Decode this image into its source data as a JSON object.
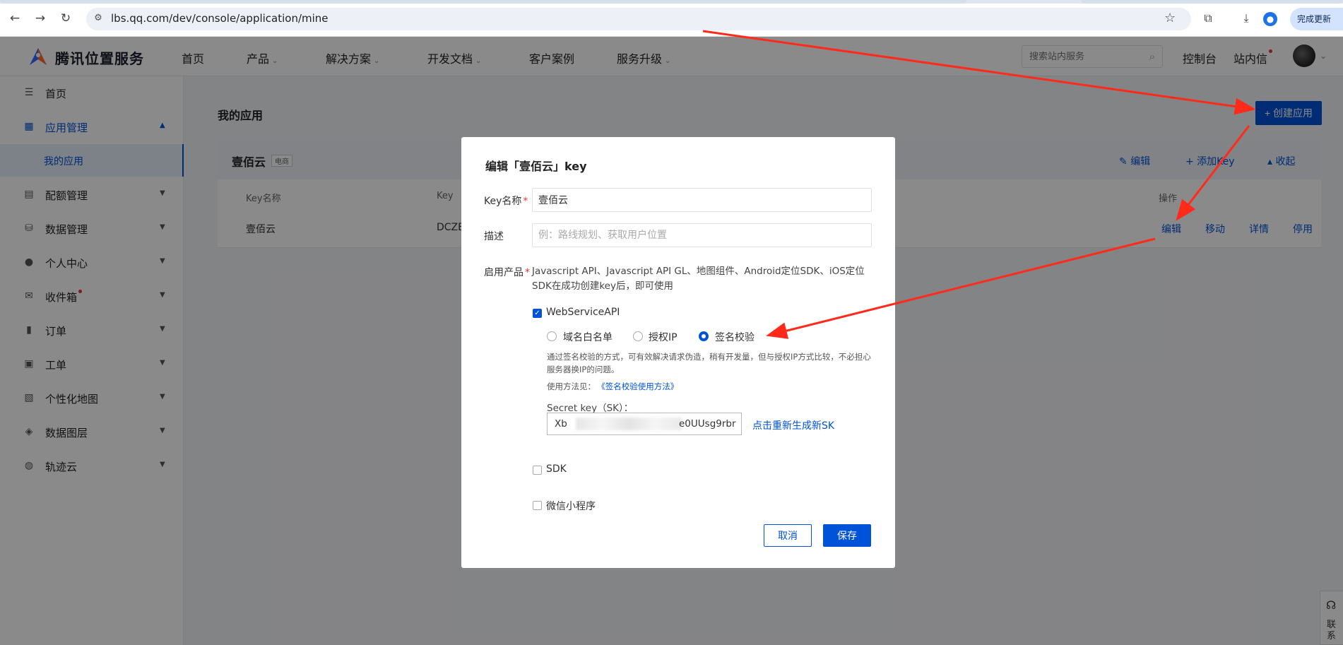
{
  "browser": {
    "url": "lbs.qq.com/dev/console/application/mine",
    "update_button": "完成更新"
  },
  "header": {
    "logo_text": "腾讯位置服务",
    "nav": [
      "首页",
      "产品",
      "解决方案",
      "开发文档",
      "客户案例",
      "服务升级"
    ],
    "search_placeholder": "搜索站内服务",
    "console_link": "控制台",
    "inbox_link": "站内信"
  },
  "sidebar": {
    "items": [
      {
        "label": "首页",
        "icon": "list-icon"
      },
      {
        "label": "应用管理",
        "icon": "grid-icon"
      },
      {
        "label": "我的应用"
      },
      {
        "label": "配额管理",
        "icon": "chart-icon"
      },
      {
        "label": "数据管理",
        "icon": "database-icon"
      },
      {
        "label": "个人中心",
        "icon": "user-icon"
      },
      {
        "label": "收件箱",
        "icon": "mail-icon"
      },
      {
        "label": "订单",
        "icon": "clipboard-icon"
      },
      {
        "label": "工单",
        "icon": "ticket-icon"
      },
      {
        "label": "个性化地图",
        "icon": "map-style-icon"
      },
      {
        "label": "数据图层",
        "icon": "layers-icon"
      },
      {
        "label": "轨迹云",
        "icon": "track-icon"
      }
    ]
  },
  "main": {
    "title": "我的应用",
    "create_button": "+ 创建应用",
    "app": {
      "name": "壹佰云",
      "tag": "电商",
      "actions": [
        "编辑",
        "添加Key",
        "收起"
      ],
      "columns": [
        "Key名称",
        "Key",
        "操作"
      ],
      "row": {
        "key_name": "壹佰云",
        "key": "DCZE",
        "actions": [
          "编辑",
          "移动",
          "详情",
          "停用"
        ]
      }
    }
  },
  "modal": {
    "title": "编辑「壹佰云」key",
    "key_name_label": "Key名称",
    "key_name_value": "壹佰云",
    "desc_label": "描述",
    "desc_placeholder": "例：路线规划、获取用户位置",
    "products_label": "启用产品",
    "products_desc": "Javascript API、Javascript API GL、地图组件、Android定位SDK、iOS定位SDK在成功创建key后，即可使用",
    "webservice_label": "WebServiceAPI",
    "webservice_checked": true,
    "radio_options": [
      "域名白名单",
      "授权IP",
      "签名校验"
    ],
    "radio_selected": "签名校验",
    "hint": "通过签名校验的方式，可有效解决请求伪造，稍有开发量，但与授权IP方式比较，不必担心服务器换IP的问题。",
    "usage_label": "使用方法见：",
    "usage_link": "《签名校验使用方法》",
    "sk_label": "Secret key（SK）：",
    "sk_prefix": "Xb",
    "sk_suffix": "e0UUsg9rbr",
    "sk_regen": "点击重新生成新SK",
    "sdk_label": "SDK",
    "sdk_checked": false,
    "miniprogram_label": "微信小程序",
    "miniprogram_checked": false,
    "cancel": "取消",
    "save": "保存"
  },
  "contact": {
    "label": "联系"
  },
  "colors": {
    "primary": "#0052d9",
    "annotation_arrow": "#ff2a1a",
    "required": "#e53935"
  }
}
